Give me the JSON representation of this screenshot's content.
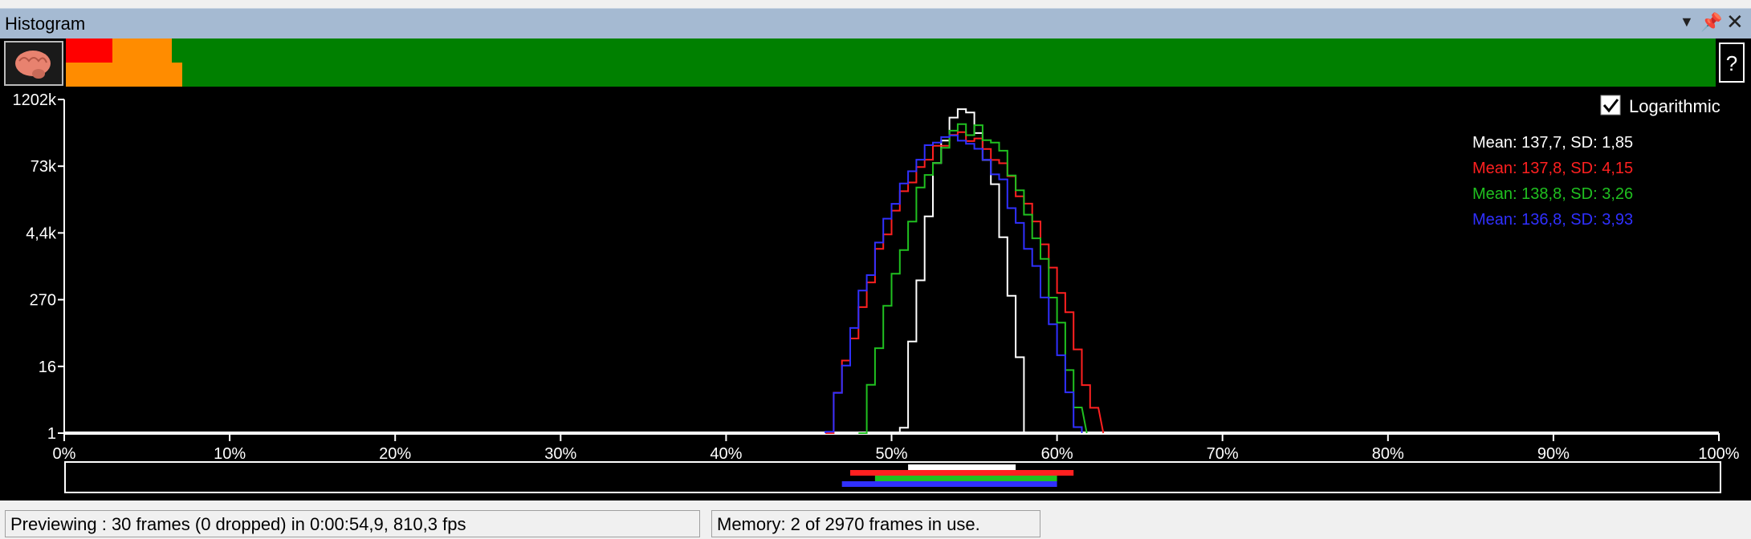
{
  "window": {
    "title": "Histogram",
    "icons": [
      "dropdown-icon",
      "pin-icon",
      "close-icon"
    ]
  },
  "toolbar": {
    "help_label": "?",
    "brain_icon": "brain-icon"
  },
  "controls": {
    "logarithmic_label": "Logarithmic",
    "logarithmic_checked": true
  },
  "stats": [
    {
      "text": "Mean: 137,7, SD: 1,85",
      "color": "#ffffff"
    },
    {
      "text": "Mean: 137,8, SD: 4,15",
      "color": "#ff2020"
    },
    {
      "text": "Mean: 138,8, SD: 3,26",
      "color": "#20c020"
    },
    {
      "text": "Mean: 136,8, SD: 3,93",
      "color": "#3030ff"
    }
  ],
  "chart_data": {
    "type": "line",
    "yscale": "log",
    "y_tick_labels": [
      "1202k",
      "73k",
      "4,4k",
      "270",
      "16",
      "1"
    ],
    "x_tick_labels": [
      "0%",
      "10%",
      "20%",
      "30%",
      "40%",
      "50%",
      "60%",
      "70%",
      "80%",
      "90%",
      "100%"
    ],
    "xlim": [
      0,
      100
    ],
    "ylim": [
      1,
      1202000
    ],
    "series": [
      {
        "color": "#ffffff",
        "range": [
          50.5,
          58.0
        ],
        "peak_x": 54.0,
        "peak_y": 800000
      },
      {
        "color": "#ff2020",
        "range": [
          46.0,
          62.3
        ],
        "peak_x": 54.0,
        "peak_y": 250000
      },
      {
        "color": "#20c020",
        "range": [
          48.0,
          61.3
        ],
        "peak_x": 54.5,
        "peak_y": 350000
      },
      {
        "color": "#3030ff",
        "range": [
          46.0,
          61.0
        ],
        "peak_x": 53.5,
        "peak_y": 250000
      }
    ],
    "range_bars": [
      {
        "color": "#ffffff",
        "from": 51.0,
        "to": 57.5
      },
      {
        "color": "#ff2020",
        "from": 47.5,
        "to": 61.0
      },
      {
        "color": "#20c020",
        "from": 49.0,
        "to": 60.0
      },
      {
        "color": "#3030ff",
        "from": 47.0,
        "to": 60.0
      }
    ],
    "grid": false
  },
  "status": {
    "preview": "Previewing : 30 frames (0 dropped) in 0:00:54,9, 810,3 fps",
    "memory": "Memory: 2 of 2970 frames in use."
  }
}
